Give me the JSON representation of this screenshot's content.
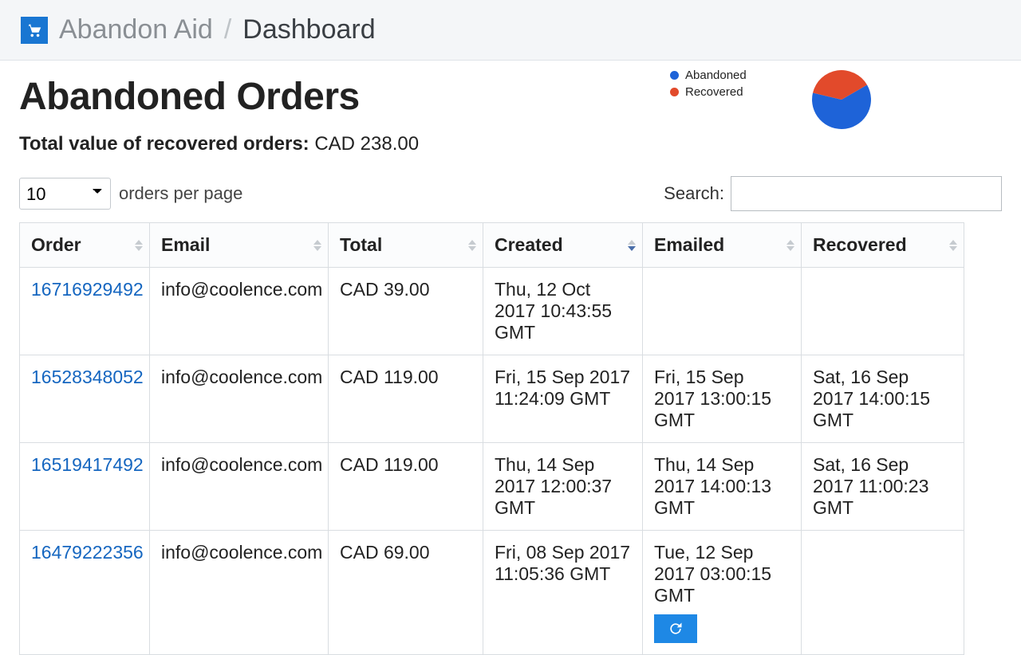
{
  "header": {
    "app_name": "Abandon Aid",
    "separator": "/",
    "page": "Dashboard"
  },
  "title": "Abandoned Orders",
  "kpi": {
    "label": "Total value of recovered orders:",
    "value": "CAD 238.00"
  },
  "legend": {
    "abandoned": {
      "label": "Abandoned",
      "color": "#1e63d8"
    },
    "recovered": {
      "label": "Recovered",
      "color": "#e24a2b"
    }
  },
  "chart_data": {
    "type": "pie",
    "series": [
      {
        "name": "Abandoned",
        "value": 62,
        "color": "#1e63d8"
      },
      {
        "name": "Recovered",
        "value": 38,
        "color": "#e24a2b"
      }
    ],
    "title": ""
  },
  "controls": {
    "per_page_value": "10",
    "per_page_label": "orders per page",
    "search_label": "Search:",
    "search_value": ""
  },
  "table": {
    "columns": {
      "order": "Order",
      "email": "Email",
      "total": "Total",
      "created": "Created",
      "emailed": "Emailed",
      "recovered": "Recovered"
    },
    "sorted_column": "created",
    "sort_dir": "desc",
    "rows": [
      {
        "order": "16716929492",
        "email": "info@coolence.com",
        "total": "CAD 39.00",
        "created": "Thu, 12 Oct 2017 10:43:55 GMT",
        "emailed": "",
        "recovered": "",
        "has_refresh": false
      },
      {
        "order": "16528348052",
        "email": "info@coolence.com",
        "total": "CAD 119.00",
        "created": "Fri, 15 Sep 2017 11:24:09 GMT",
        "emailed": "Fri, 15 Sep 2017 13:00:15 GMT",
        "recovered": "Sat, 16 Sep 2017 14:00:15 GMT",
        "has_refresh": false
      },
      {
        "order": "16519417492",
        "email": "info@coolence.com",
        "total": "CAD 119.00",
        "created": "Thu, 14 Sep 2017 12:00:37 GMT",
        "emailed": "Thu, 14 Sep 2017 14:00:13 GMT",
        "recovered": "Sat, 16 Sep 2017 11:00:23 GMT",
        "has_refresh": false
      },
      {
        "order": "16479222356",
        "email": "info@coolence.com",
        "total": "CAD 69.00",
        "created": "Fri, 08 Sep 2017 11:05:36 GMT",
        "emailed": "Tue, 12 Sep 2017 03:00:15 GMT",
        "recovered": "",
        "has_refresh": true
      }
    ]
  }
}
